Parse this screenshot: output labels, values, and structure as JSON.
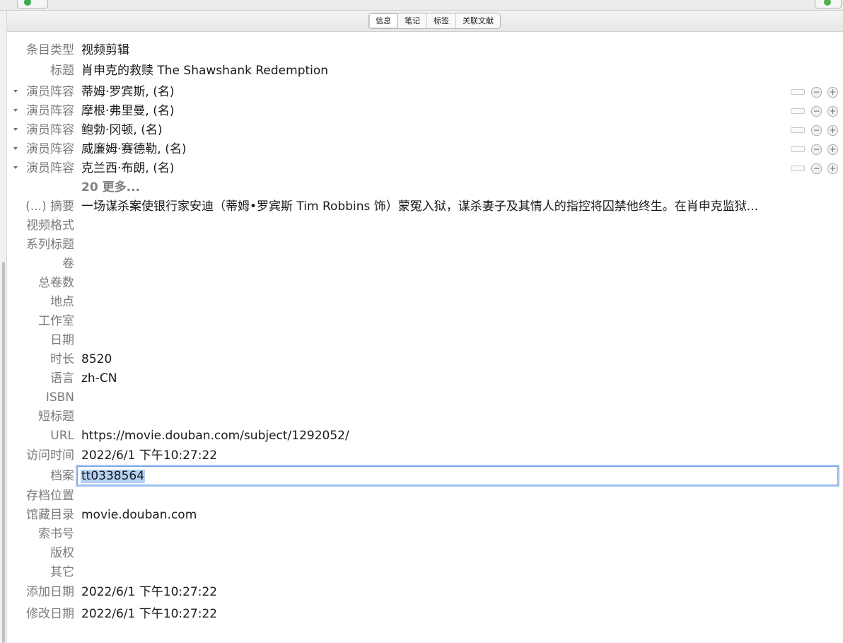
{
  "tabs": [
    "信息",
    "笔记",
    "标签",
    "关联文献"
  ],
  "fields": {
    "item_type": {
      "label": "条目类型",
      "value": "视频剪辑"
    },
    "title": {
      "label": "标题",
      "value": "肖申克的救赎 The Shawshank Redemption"
    },
    "cast": [
      {
        "label": "演员阵容",
        "value": "蒂姆·罗宾斯, (名)"
      },
      {
        "label": "演员阵容",
        "value": "摩根·弗里曼, (名)"
      },
      {
        "label": "演员阵容",
        "value": "鲍勃·冈顿, (名)"
      },
      {
        "label": "演员阵容",
        "value": "威廉姆·赛德勒, (名)"
      },
      {
        "label": "演员阵容",
        "value": "克兰西·布朗, (名)"
      }
    ],
    "more_creators": "20 更多...",
    "abstract": {
      "label": "(...) 摘要",
      "value": "一场谋杀案使银行家安迪（蒂姆•罗宾斯 Tim Robbins 饰）蒙冤入狱，谋杀妻子及其情人的指控将囚禁他终生。在肖申克监狱..."
    },
    "video_format": {
      "label": "视频格式",
      "value": ""
    },
    "series_title": {
      "label": "系列标题",
      "value": ""
    },
    "volume": {
      "label": "卷",
      "value": ""
    },
    "num_volumes": {
      "label": "总卷数",
      "value": ""
    },
    "place": {
      "label": "地点",
      "value": ""
    },
    "studio": {
      "label": "工作室",
      "value": ""
    },
    "date": {
      "label": "日期",
      "value": ""
    },
    "runtime": {
      "label": "时长",
      "value": "8520"
    },
    "language": {
      "label": "语言",
      "value": "zh-CN"
    },
    "isbn": {
      "label": "ISBN",
      "value": ""
    },
    "short_title": {
      "label": "短标题",
      "value": ""
    },
    "url": {
      "label": "URL",
      "value": "https://movie.douban.com/subject/1292052/"
    },
    "accessed": {
      "label": "访问时间",
      "value": "2022/6/1 下午10:27:22"
    },
    "archive": {
      "label": "档案",
      "value": "tt0338564"
    },
    "archive_location": {
      "label": "存档位置",
      "value": ""
    },
    "library_catalog": {
      "label": "馆藏目录",
      "value": "movie.douban.com"
    },
    "call_number": {
      "label": "索书号",
      "value": ""
    },
    "rights": {
      "label": "版权",
      "value": ""
    },
    "extra": {
      "label": "其它",
      "value": ""
    },
    "date_added": {
      "label": "添加日期",
      "value": "2022/6/1 下午10:27:22"
    },
    "date_modified": {
      "label": "修改日期",
      "value": "2022/6/1 下午10:27:22"
    }
  }
}
